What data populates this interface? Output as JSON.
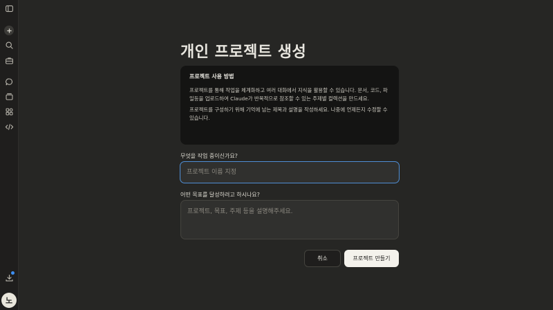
{
  "page": {
    "title": "개인 프로젝트 생성"
  },
  "info_card": {
    "heading": "프로젝트 사용 방법",
    "paragraph1": "프로젝트를 통해 작업을 체계화하고 여러 대화에서 지식을 활용할 수 있습니다. 문서, 코드, 파일등을 업로드하여 Claude가 반복적으로 참조할 수 있는 주제별 컬렉션을 만드세요.",
    "paragraph2": "프로젝트를 구성하기 위해 기억에 남는 제목과 설명을 작성하세요. 나중에 언제든지 수정할 수 있습니다."
  },
  "form": {
    "name_label": "무엇을 작업 중이신가요?",
    "name_value": "",
    "name_placeholder": "프로젝트 이름 지정",
    "desc_label": "어떤 목표를 달성하려고 하시나요?",
    "desc_value": "",
    "desc_placeholder": "프로젝트, 목표, 주제 등을 설명해주세요."
  },
  "actions": {
    "cancel_label": "취소",
    "create_label": "프로젝트 만들기"
  },
  "sidebar": {
    "icons": [
      "sidebar-toggle-icon",
      "new-chat-icon",
      "search-icon",
      "briefcase-icon",
      "chat-bubble-icon",
      "projects-icon",
      "artifacts-icon",
      "code-icon",
      "download-icon"
    ],
    "avatar_initial": "노"
  },
  "colors": {
    "background": "#262624",
    "card": "#141413",
    "focus_ring": "#4f8fd6",
    "primary_button": "#f4f2ec",
    "notification_dot": "#3d8ef0"
  }
}
